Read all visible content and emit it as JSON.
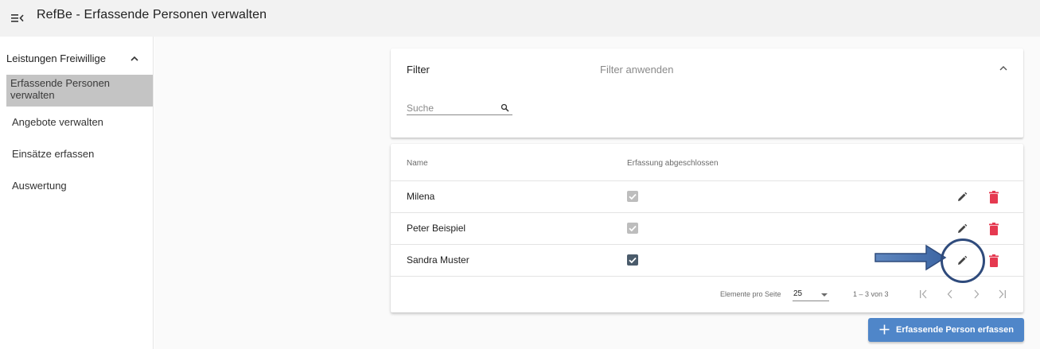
{
  "header": {
    "title": "RefBe - Erfassende Personen verwalten",
    "menu_icon": "menu-collapse-icon"
  },
  "sidebar": {
    "group_label": "Leistungen Freiwillige",
    "items": [
      {
        "label": "Erfassende Personen verwalten",
        "active": true
      },
      {
        "label": "Angebote verwalten",
        "active": false
      },
      {
        "label": "Einsätze erfassen",
        "active": false
      },
      {
        "label": "Auswertung",
        "active": false
      }
    ]
  },
  "filter": {
    "title": "Filter",
    "description": "Filter anwenden",
    "search_placeholder": "Suche",
    "search_value": ""
  },
  "table": {
    "columns": [
      "Name",
      "Erfassung abgeschlossen"
    ],
    "rows": [
      {
        "name": "Milena",
        "completed": true,
        "checkbox_enabled": false
      },
      {
        "name": "Peter Beispiel",
        "completed": true,
        "checkbox_enabled": false
      },
      {
        "name": "Sandra Muster",
        "completed": true,
        "checkbox_enabled": true
      }
    ]
  },
  "paginator": {
    "items_per_page_label": "Elemente pro Seite",
    "items_per_page": "25",
    "range_label": "1 – 3 von 3"
  },
  "add_button": {
    "label": "Erfassende Person erfassen"
  },
  "colors": {
    "primary": "#4f86c9",
    "delete": "#e53950",
    "active_sidebar": "#c4c4c4",
    "annotation": "#2f4b7c"
  }
}
